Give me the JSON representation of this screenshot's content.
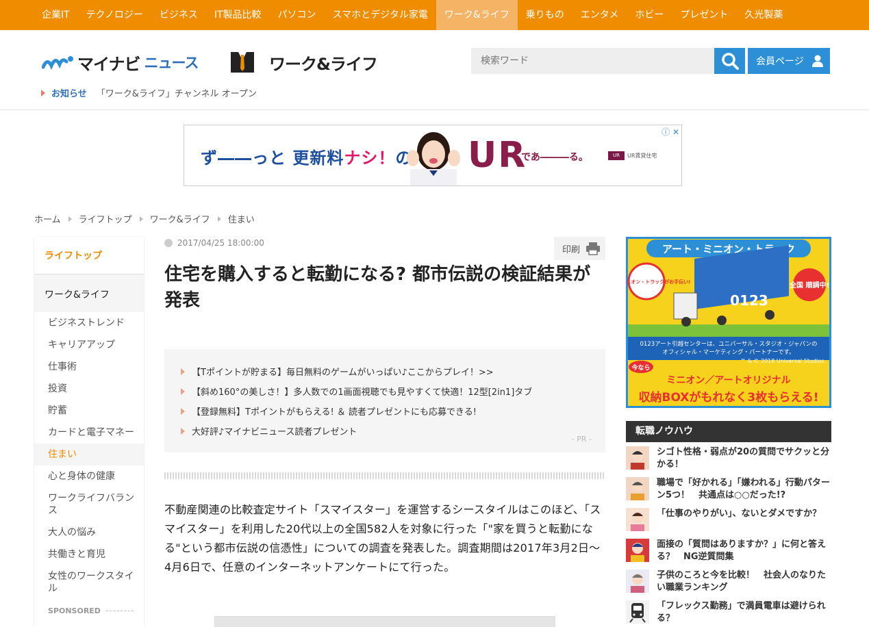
{
  "topnav": {
    "items": [
      "企業IT",
      "テクノロジー",
      "ビジネス",
      "IT製品比較",
      "パソコン",
      "スマホとデジタル家電",
      "ワーク&ライフ",
      "乗りもの",
      "エンタメ",
      "ホビー",
      "プレゼント",
      "久光製薬"
    ],
    "active_index": 6
  },
  "header": {
    "logo_part1": "マイナビ",
    "logo_part2": "ニュース",
    "channel_title": "ワーク&ライフ",
    "search_placeholder": "検索ワード",
    "member_label": "会員ページ",
    "notice_label": "お知らせ",
    "notice_text": "「ワーク&ライフ」チャンネル オープン"
  },
  "ad_banner": {
    "copy1a": "ず――っと 更新料",
    "copy1b": "ナシ！",
    "copy1c": "の",
    "ur": "UR",
    "copy2": "であ―――る。",
    "brand": "UR賃貸住宅"
  },
  "breadcrumb": [
    "ホーム",
    "ライフトップ",
    "ワーク&ライフ",
    "住まい"
  ],
  "sidebar": {
    "top": "ライフトップ",
    "category": "ワーク&ライフ",
    "items": [
      "ビジネストレンド",
      "キャリアアップ",
      "仕事術",
      "投資",
      "貯蓄",
      "カードと電子マネー",
      "住まい",
      "心と身体の健康",
      "ワークライフバランス",
      "大人の悩み",
      "共働きと育児",
      "女性のワークスタイル"
    ],
    "active_index": 6,
    "sponsored": "SPONSORED"
  },
  "article": {
    "date": "2017/04/25 18:00:00",
    "print_label": "印刷",
    "title": "住宅を購入すると転勤になる? 都市伝説の検証結果が発表",
    "pr_items": [
      "【Tポイントが貯まる】毎日無料のゲームがいっぱい♪ここからプレイ！>>",
      "【斜め160°の美しさ！】多人数での1画面視聴でも見やすくて快適！12型[2in1]タブ",
      "【登録無料】Tポイントがもらえる! ＆ 読者プレゼントにも応募できる!",
      "大好評♪マイナビニュース読者プレゼント"
    ],
    "pr_tag": "- PR -",
    "body": "不動産関連の比較査定サイト「スマイスター」を運営するシースタイルはこのほど、「スマイスター」を利用した20代以上の全国582人を対象に行った「\"家を買うと転勤になる\"という都市伝説の信憑性」についての調査を発表した。調査期間は2017年3月2日～4月6日で、任意のインターネットアンケートにて行った。"
  },
  "right_ad": {
    "title": "アート・ミニオン・トラック",
    "bubble": "アート・ミニオン・トラックがお手伝い!",
    "badge": "全国 順調中!",
    "truck_label": "0123",
    "caption1": "0123アート引越センターは、ユニバーサル・スタジオ・ジャパンの",
    "caption2": "オフィシャル・マーケティング・パートナーです。",
    "copyright": "™ & © 2018 Universal Studios.",
    "now": "今なら",
    "promo1": "ミニオン／アートオリジナル",
    "promo2": "収納BOXがもれなく3枚もらえる!"
  },
  "side_section": {
    "title": "転職ノウハウ",
    "items": [
      "シゴト性格・弱点が20の質問でサクッと分かる！",
      "職場で「好かれる」「嫌われる」行動パターン5つ！　共通点は○○だった!?",
      "「仕事のやりがい」、ないとダメですか？",
      "面接の「質問はありますか？」に何と答える？　NG逆質問集",
      "子供のころと今を比較！　社会人のなりたい職業ランキング",
      "「フレックス勤務」で満員電車は避けられる？"
    ]
  }
}
